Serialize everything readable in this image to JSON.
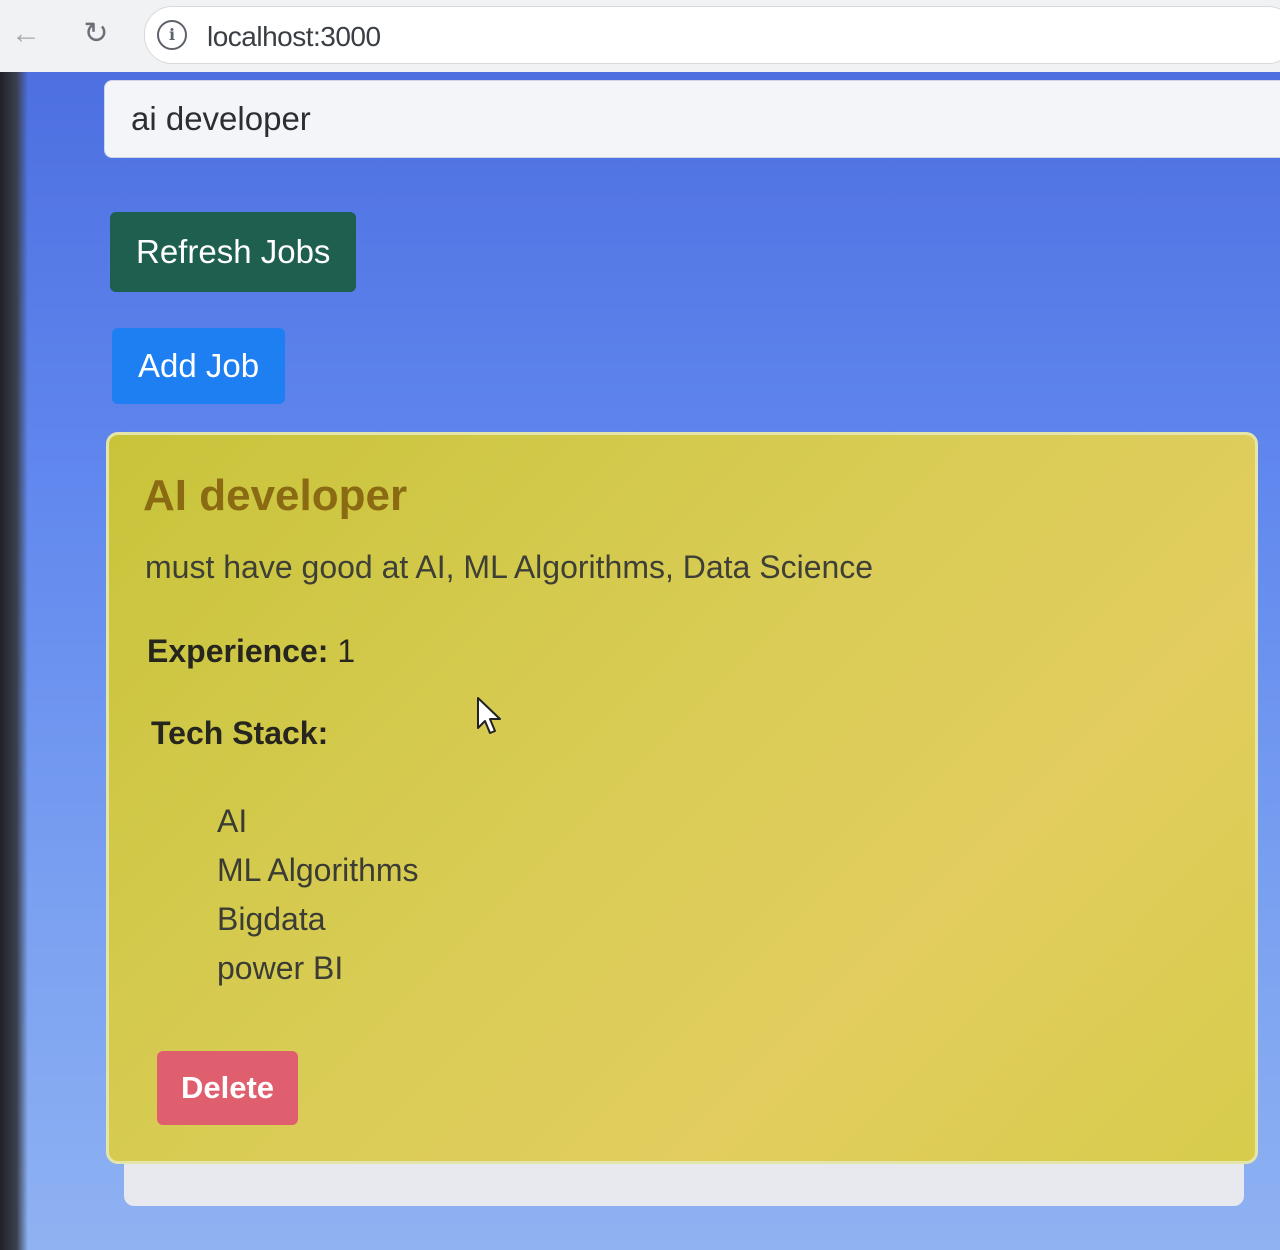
{
  "browser": {
    "url": "localhost:3000",
    "back_icon": "arrow-left-icon",
    "reload_icon": "reload-icon",
    "info_icon": "info-icon"
  },
  "search": {
    "value": "ai developer"
  },
  "toolbar": {
    "refresh_label": "Refresh Jobs",
    "add_label": "Add Job"
  },
  "job": {
    "title": "AI developer",
    "description": "must have good at AI, ML Algorithms, Data Science",
    "experience_label": "Experience:",
    "experience_value": "1",
    "tech_stack_label": "Tech Stack:",
    "tech_stack": [
      "AI",
      "ML Algorithms",
      "Bigdata",
      "power BI"
    ],
    "delete_label": "Delete"
  },
  "colors": {
    "refresh_button": "#1e5f4f",
    "add_button": "#1d7ff2",
    "delete_button": "#e05f6e",
    "card_background": "#d9cc55",
    "title_color": "#8a6a12",
    "page_background": "#6188ee"
  }
}
